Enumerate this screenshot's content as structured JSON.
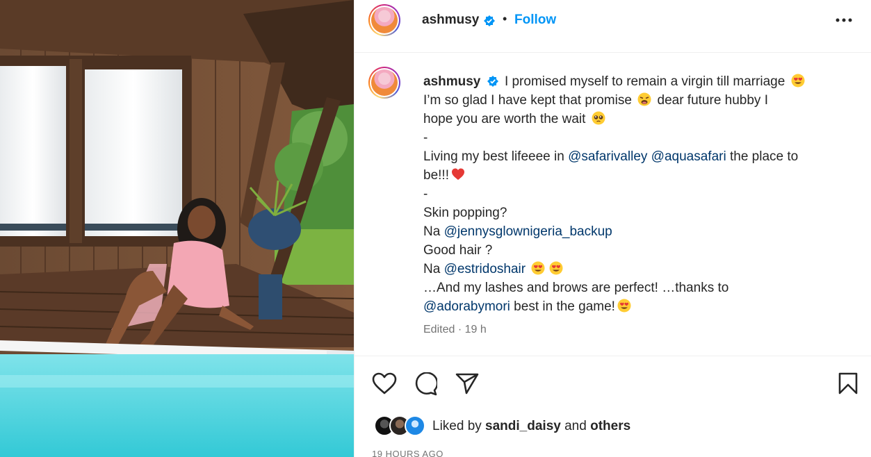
{
  "post": {
    "author": "ashmusy",
    "follow_label": "Follow",
    "separator": "•",
    "caption_lines": [
      {
        "parts": [
          {
            "t": "text",
            "v": "I promised myself to remain a virgin till marriage "
          },
          {
            "t": "emoji",
            "v": "heart-eyes-emoji"
          }
        ]
      },
      {
        "parts": [
          {
            "t": "text",
            "v": "I’m so glad I have kept that promise "
          },
          {
            "t": "emoji",
            "v": "weary-face-emoji"
          },
          {
            "t": "text",
            "v": " dear future hubby I"
          }
        ]
      },
      {
        "parts": [
          {
            "t": "text",
            "v": "hope you are worth the wait "
          },
          {
            "t": "emoji",
            "v": "pleading-face-emoji"
          }
        ]
      },
      {
        "parts": [
          {
            "t": "text",
            "v": "-"
          }
        ]
      },
      {
        "parts": [
          {
            "t": "text",
            "v": "Living my best lifeeee in "
          },
          {
            "t": "mention",
            "v": "@safarivalley"
          },
          {
            "t": "text",
            "v": " "
          },
          {
            "t": "mention",
            "v": "@aquasafari"
          },
          {
            "t": "text",
            "v": " the place to"
          }
        ]
      },
      {
        "parts": [
          {
            "t": "text",
            "v": "be!!!"
          },
          {
            "t": "emoji",
            "v": "red-heart-emoji"
          }
        ]
      },
      {
        "parts": [
          {
            "t": "text",
            "v": "-"
          }
        ]
      },
      {
        "parts": [
          {
            "t": "text",
            "v": "Skin popping?"
          }
        ]
      },
      {
        "parts": [
          {
            "t": "text",
            "v": "Na "
          },
          {
            "t": "mention",
            "v": "@jennysglownigeria_backup"
          }
        ]
      },
      {
        "parts": [
          {
            "t": "text",
            "v": "Good hair ?"
          }
        ]
      },
      {
        "parts": [
          {
            "t": "text",
            "v": "Na "
          },
          {
            "t": "mention",
            "v": "@estridoshair"
          },
          {
            "t": "text",
            "v": " "
          },
          {
            "t": "emoji",
            "v": "heart-eyes-emoji"
          },
          {
            "t": "emoji",
            "v": "heart-eyes-emoji"
          }
        ]
      },
      {
        "parts": [
          {
            "t": "text",
            "v": "…And my lashes and brows are perfect! …thanks to"
          }
        ]
      },
      {
        "parts": [
          {
            "t": "mention",
            "v": "@adorabymori"
          },
          {
            "t": "text",
            "v": " best in the game!"
          },
          {
            "t": "emoji",
            "v": "heart-eyes-emoji"
          }
        ]
      }
    ],
    "meta": "Edited · 19 h",
    "likes": {
      "prefix": "Liked by ",
      "user": "sandi_daisy",
      "middle": " and ",
      "others": "others"
    },
    "timestamp": "19 HOURS AGO"
  },
  "colors": {
    "link_blue": "#0095f6",
    "mention_blue": "#00376b",
    "text": "#262626",
    "secondary": "#737373"
  }
}
